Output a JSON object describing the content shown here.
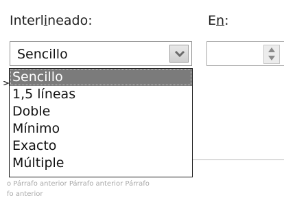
{
  "spacing": {
    "label_text": "Interlineado:",
    "selected_value": "Sencillo",
    "options": [
      "Sencillo",
      "1,5 líneas",
      "Doble",
      "Mínimo",
      "Exacto",
      "Múltiple"
    ]
  },
  "at": {
    "label_text": "En:",
    "value": ""
  },
  "preview": {
    "line1": "o Párrafo anterior Párrafo anterior Párrafo",
    "line2": "fo anterior"
  },
  "icons": {
    "combo_arrow": "chevron-down-icon",
    "spin": "spin-up-down-icon"
  },
  "colors": {
    "highlight": "#7b7b7b",
    "border": "#8e8e8e"
  }
}
